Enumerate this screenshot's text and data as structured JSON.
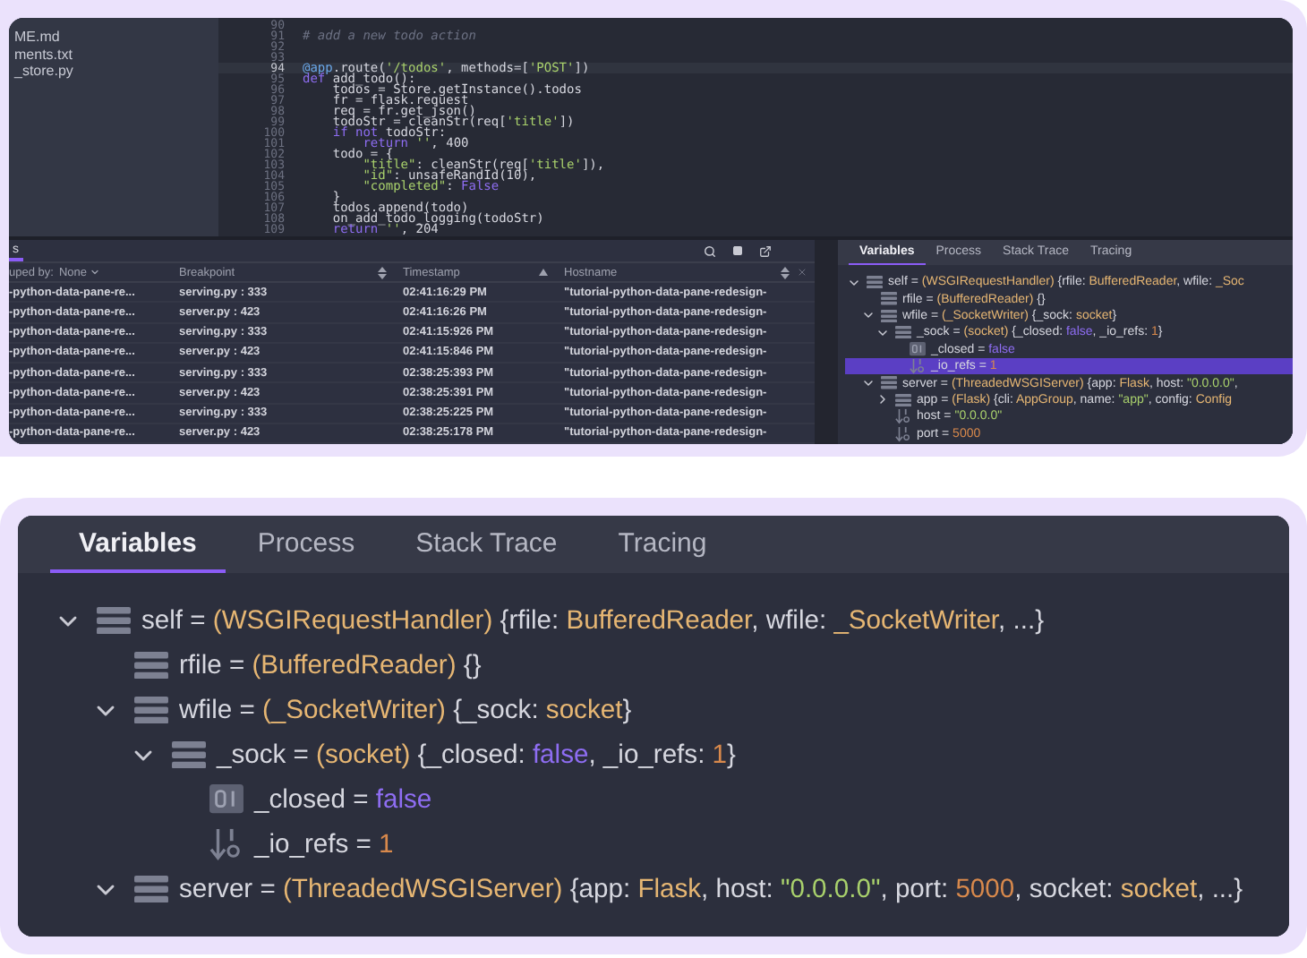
{
  "editor": {
    "files": [
      {
        "label": "ME.md"
      },
      {
        "label": "ments.txt"
      },
      {
        "label": "_store.py"
      }
    ],
    "lines": [
      {
        "number": "90",
        "current": false
      },
      {
        "number": "91",
        "current": false,
        "code": [
          {
            "kind": "comment",
            "text": "# add a new todo action"
          }
        ]
      },
      {
        "number": "92",
        "current": false
      },
      {
        "number": "93",
        "current": false
      },
      {
        "number": "94",
        "current": true,
        "code": [
          {
            "kind": "decorator",
            "text": "@app"
          },
          {
            "kind": "plain",
            "text": ".route("
          },
          {
            "kind": "string",
            "text": "'/todos'"
          },
          {
            "kind": "plain",
            "text": ", methods=["
          },
          {
            "kind": "string",
            "text": "'POST'"
          },
          {
            "kind": "plain",
            "text": "])"
          }
        ]
      },
      {
        "number": "95",
        "current": false,
        "code": [
          {
            "kind": "keyword",
            "text": "def"
          },
          {
            "kind": "plain",
            "text": " add_todo():"
          }
        ]
      },
      {
        "number": "96",
        "current": false,
        "code": [
          {
            "kind": "plain",
            "text": "    todos = Store.getInstance().todos"
          }
        ]
      },
      {
        "number": "97",
        "current": false,
        "code": [
          {
            "kind": "plain",
            "text": "    fr = flask.request"
          }
        ]
      },
      {
        "number": "98",
        "current": false,
        "code": [
          {
            "kind": "plain",
            "text": "    req = fr.get_json()"
          }
        ]
      },
      {
        "number": "99",
        "current": false,
        "code": [
          {
            "kind": "plain",
            "text": "    todoStr = cleanStr(req["
          },
          {
            "kind": "string",
            "text": "'title'"
          },
          {
            "kind": "plain",
            "text": "])"
          }
        ]
      },
      {
        "number": "100",
        "current": false,
        "code": [
          {
            "kind": "keyword",
            "text": "    if not"
          },
          {
            "kind": "plain",
            "text": " todoStr:"
          }
        ]
      },
      {
        "number": "101",
        "current": false,
        "code": [
          {
            "kind": "keyword",
            "text": "        return"
          },
          {
            "kind": "string",
            "text": " ''"
          },
          {
            "kind": "plain",
            "text": ", 400"
          }
        ]
      },
      {
        "number": "102",
        "current": false,
        "code": [
          {
            "kind": "plain",
            "text": "    todo = {"
          }
        ]
      },
      {
        "number": "103",
        "current": false,
        "code": [
          {
            "kind": "string",
            "text": "        \"title\""
          },
          {
            "kind": "plain",
            "text": ": cleanStr(req["
          },
          {
            "kind": "string",
            "text": "'title'"
          },
          {
            "kind": "plain",
            "text": "]),"
          }
        ]
      },
      {
        "number": "104",
        "current": false,
        "code": [
          {
            "kind": "string",
            "text": "        \"id\""
          },
          {
            "kind": "plain",
            "text": ": unsafeRandId(10),"
          }
        ]
      },
      {
        "number": "105",
        "current": false,
        "code": [
          {
            "kind": "string",
            "text": "        \"completed\""
          },
          {
            "kind": "plain",
            "text": ": "
          },
          {
            "kind": "keyword",
            "text": "False"
          }
        ]
      },
      {
        "number": "106",
        "current": false,
        "code": [
          {
            "kind": "plain",
            "text": "    }"
          }
        ]
      },
      {
        "number": "107",
        "current": false,
        "code": [
          {
            "kind": "plain",
            "text": "    todos.append(todo)"
          }
        ]
      },
      {
        "number": "108",
        "current": false,
        "code": [
          {
            "kind": "plain",
            "text": "    on_add_todo_logging(todoStr)"
          }
        ]
      },
      {
        "number": "109",
        "current": false,
        "code": [
          {
            "kind": "keyword",
            "text": "    return"
          },
          {
            "kind": "string",
            "text": " ''"
          },
          {
            "kind": "plain",
            "text": ", 204"
          }
        ]
      }
    ]
  },
  "debug_table": {
    "tab": {
      "label": "s",
      "selected": true
    },
    "columns": [
      {
        "kind": "group_by",
        "label": "uped by:",
        "value": "None"
      },
      {
        "kind": "plain",
        "label": "Breakpoint",
        "sorted": false
      },
      {
        "kind": "plain",
        "label": "Timestamp",
        "sorted": true
      },
      {
        "kind": "plain",
        "label": "Hostname",
        "sorted": false
      }
    ],
    "rows": [
      [
        "-python-data-pane-re...",
        "serving.py : 333",
        "02:41:16:29 PM",
        "\"tutorial-python-data-pane-redesign-"
      ],
      [
        "-python-data-pane-re...",
        "server.py : 423",
        "02:41:16:26 PM",
        "\"tutorial-python-data-pane-redesign-"
      ],
      [
        "-python-data-pane-re...",
        "serving.py : 333",
        "02:41:15:926 PM",
        "\"tutorial-python-data-pane-redesign-"
      ],
      [
        "-python-data-pane-re...",
        "server.py : 423",
        "02:41:15:846 PM",
        "\"tutorial-python-data-pane-redesign-"
      ],
      [
        "-python-data-pane-re...",
        "serving.py : 333",
        "02:38:25:393 PM",
        "\"tutorial-python-data-pane-redesign-"
      ],
      [
        "-python-data-pane-re...",
        "server.py : 423",
        "02:38:25:391 PM",
        "\"tutorial-python-data-pane-redesign-"
      ],
      [
        "-python-data-pane-re...",
        "serving.py : 333",
        "02:38:25:225 PM",
        "\"tutorial-python-data-pane-redesign-"
      ],
      [
        "-python-data-pane-re...",
        "server.py : 423",
        "02:38:25:178 PM",
        "\"tutorial-python-data-pane-redesign-"
      ]
    ]
  },
  "variables_small": {
    "tabs": [
      {
        "label": "Variables",
        "selected": true
      },
      {
        "label": "Process",
        "selected": false
      },
      {
        "label": "Stack Trace",
        "selected": false
      },
      {
        "label": "Tracing",
        "selected": false
      }
    ],
    "tree": [
      {
        "kind": "object",
        "expanded": true,
        "selected": false,
        "text": [
          {
            "kind": "plain",
            "text": "self = "
          },
          {
            "kind": "type",
            "text": "(WSGIRequestHandler)"
          },
          {
            "kind": "plain",
            "text": " {rfile: "
          },
          {
            "kind": "type",
            "text": "BufferedReader"
          },
          {
            "kind": "plain",
            "text": ", wfile: "
          },
          {
            "kind": "type",
            "text": "_Soc"
          }
        ],
        "children": [
          {
            "kind": "object",
            "selected": false,
            "text": [
              {
                "kind": "plain",
                "text": "rfile = "
              },
              {
                "kind": "type",
                "text": "(BufferedReader)"
              },
              {
                "kind": "plain",
                "text": " {}"
              }
            ]
          },
          {
            "kind": "object",
            "expanded": true,
            "selected": false,
            "text": [
              {
                "kind": "plain",
                "text": "wfile = "
              },
              {
                "kind": "type",
                "text": "(_SocketWriter)"
              },
              {
                "kind": "plain",
                "text": " {_sock: "
              },
              {
                "kind": "type",
                "text": "socket"
              },
              {
                "kind": "plain",
                "text": "}"
              }
            ],
            "children": [
              {
                "kind": "object",
                "expanded": true,
                "selected": false,
                "text": [
                  {
                    "kind": "plain",
                    "text": "_sock = "
                  },
                  {
                    "kind": "type",
                    "text": "(socket)"
                  },
                  {
                    "kind": "plain",
                    "text": " {_closed: "
                  },
                  {
                    "kind": "keyword",
                    "text": "false"
                  },
                  {
                    "kind": "plain",
                    "text": ", _io_refs: "
                  },
                  {
                    "kind": "number",
                    "text": "1"
                  },
                  {
                    "kind": "plain",
                    "text": "}"
                  }
                ],
                "children": [
                  {
                    "kind": "bool",
                    "selected": false,
                    "text": [
                      {
                        "kind": "plain",
                        "text": "_closed = "
                      },
                      {
                        "kind": "keyword",
                        "text": "false"
                      }
                    ]
                  },
                  {
                    "kind": "number",
                    "selected": true,
                    "text": [
                      {
                        "kind": "plain",
                        "text": "_io_refs = "
                      },
                      {
                        "kind": "number",
                        "text": "1"
                      }
                    ]
                  }
                ]
              }
            ]
          },
          {
            "kind": "object",
            "expanded": true,
            "selected": false,
            "text": [
              {
                "kind": "plain",
                "text": "server = "
              },
              {
                "kind": "type",
                "text": "(ThreadedWSGIServer)"
              },
              {
                "kind": "plain",
                "text": " {app: "
              },
              {
                "kind": "type",
                "text": "Flask"
              },
              {
                "kind": "plain",
                "text": ", host: "
              },
              {
                "kind": "string",
                "text": "\"0.0.0.0\""
              },
              {
                "kind": "plain",
                "text": ","
              }
            ],
            "children": [
              {
                "kind": "object",
                "expanded": false,
                "selected": false,
                "text": [
                  {
                    "kind": "plain",
                    "text": "app = "
                  },
                  {
                    "kind": "type",
                    "text": "(Flask)"
                  },
                  {
                    "kind": "plain",
                    "text": " {cli: "
                  },
                  {
                    "kind": "type",
                    "text": "AppGroup"
                  },
                  {
                    "kind": "plain",
                    "text": ", name: "
                  },
                  {
                    "kind": "string",
                    "text": "\"app\""
                  },
                  {
                    "kind": "plain",
                    "text": ", config: "
                  },
                  {
                    "kind": "type",
                    "text": "Config"
                  }
                ]
              },
              {
                "kind": "string",
                "selected": false,
                "text": [
                  {
                    "kind": "plain",
                    "text": "host = "
                  },
                  {
                    "kind": "string",
                    "text": "\"0.0.0.0\""
                  }
                ]
              },
              {
                "kind": "number",
                "selected": false,
                "text": [
                  {
                    "kind": "plain",
                    "text": "port = "
                  },
                  {
                    "kind": "number",
                    "text": "5000"
                  }
                ]
              }
            ]
          }
        ]
      }
    ]
  },
  "variables": {
    "tabs": [
      {
        "label": "Variables",
        "selected": true
      },
      {
        "label": "Process",
        "selected": false
      },
      {
        "label": "Stack Trace",
        "selected": false
      },
      {
        "label": "Tracing",
        "selected": false
      }
    ],
    "tree": [
      {
        "kind": "object",
        "expanded": true,
        "selected": false,
        "text": [
          {
            "kind": "plain",
            "text": "self = "
          },
          {
            "kind": "type",
            "text": "(WSGIRequestHandler)"
          },
          {
            "kind": "plain",
            "text": " {rfile: "
          },
          {
            "kind": "type",
            "text": "BufferedReader"
          },
          {
            "kind": "plain",
            "text": ", wfile: "
          },
          {
            "kind": "type",
            "text": "_SocketWriter"
          },
          {
            "kind": "plain",
            "text": ", ...}"
          }
        ],
        "children": [
          {
            "kind": "object",
            "selected": false,
            "text": [
              {
                "kind": "plain",
                "text": "rfile = "
              },
              {
                "kind": "type",
                "text": "(BufferedReader)"
              },
              {
                "kind": "plain",
                "text": " {}"
              }
            ]
          },
          {
            "kind": "object",
            "expanded": true,
            "selected": false,
            "text": [
              {
                "kind": "plain",
                "text": "wfile = "
              },
              {
                "kind": "type",
                "text": "(_SocketWriter)"
              },
              {
                "kind": "plain",
                "text": " {_sock: "
              },
              {
                "kind": "type",
                "text": "socket"
              },
              {
                "kind": "plain",
                "text": "}"
              }
            ],
            "children": [
              {
                "kind": "object",
                "expanded": true,
                "selected": false,
                "text": [
                  {
                    "kind": "plain",
                    "text": "_sock = "
                  },
                  {
                    "kind": "type",
                    "text": "(socket)"
                  },
                  {
                    "kind": "plain",
                    "text": " {_closed: "
                  },
                  {
                    "kind": "keyword",
                    "text": "false"
                  },
                  {
                    "kind": "plain",
                    "text": ", _io_refs: "
                  },
                  {
                    "kind": "number",
                    "text": "1"
                  },
                  {
                    "kind": "plain",
                    "text": "}"
                  }
                ],
                "children": [
                  {
                    "kind": "bool",
                    "selected": false,
                    "text": [
                      {
                        "kind": "plain",
                        "text": "_closed = "
                      },
                      {
                        "kind": "keyword",
                        "text": "false"
                      }
                    ]
                  },
                  {
                    "kind": "number",
                    "selected": false,
                    "text": [
                      {
                        "kind": "plain",
                        "text": "_io_refs = "
                      },
                      {
                        "kind": "number",
                        "text": "1"
                      }
                    ]
                  }
                ]
              }
            ]
          },
          {
            "kind": "object",
            "expanded": true,
            "selected": false,
            "text": [
              {
                "kind": "plain",
                "text": "server = "
              },
              {
                "kind": "type",
                "text": "(ThreadedWSGIServer)"
              },
              {
                "kind": "plain",
                "text": " {app: "
              },
              {
                "kind": "type",
                "text": "Flask"
              },
              {
                "kind": "plain",
                "text": ", host: "
              },
              {
                "kind": "string",
                "text": "\"0.0.0.0\""
              },
              {
                "kind": "plain",
                "text": ", port: "
              },
              {
                "kind": "number",
                "text": "5000"
              },
              {
                "kind": "plain",
                "text": ", socket: "
              },
              {
                "kind": "type",
                "text": "socket"
              },
              {
                "kind": "plain",
                "text": ", ...}"
              }
            ]
          }
        ]
      }
    ]
  }
}
